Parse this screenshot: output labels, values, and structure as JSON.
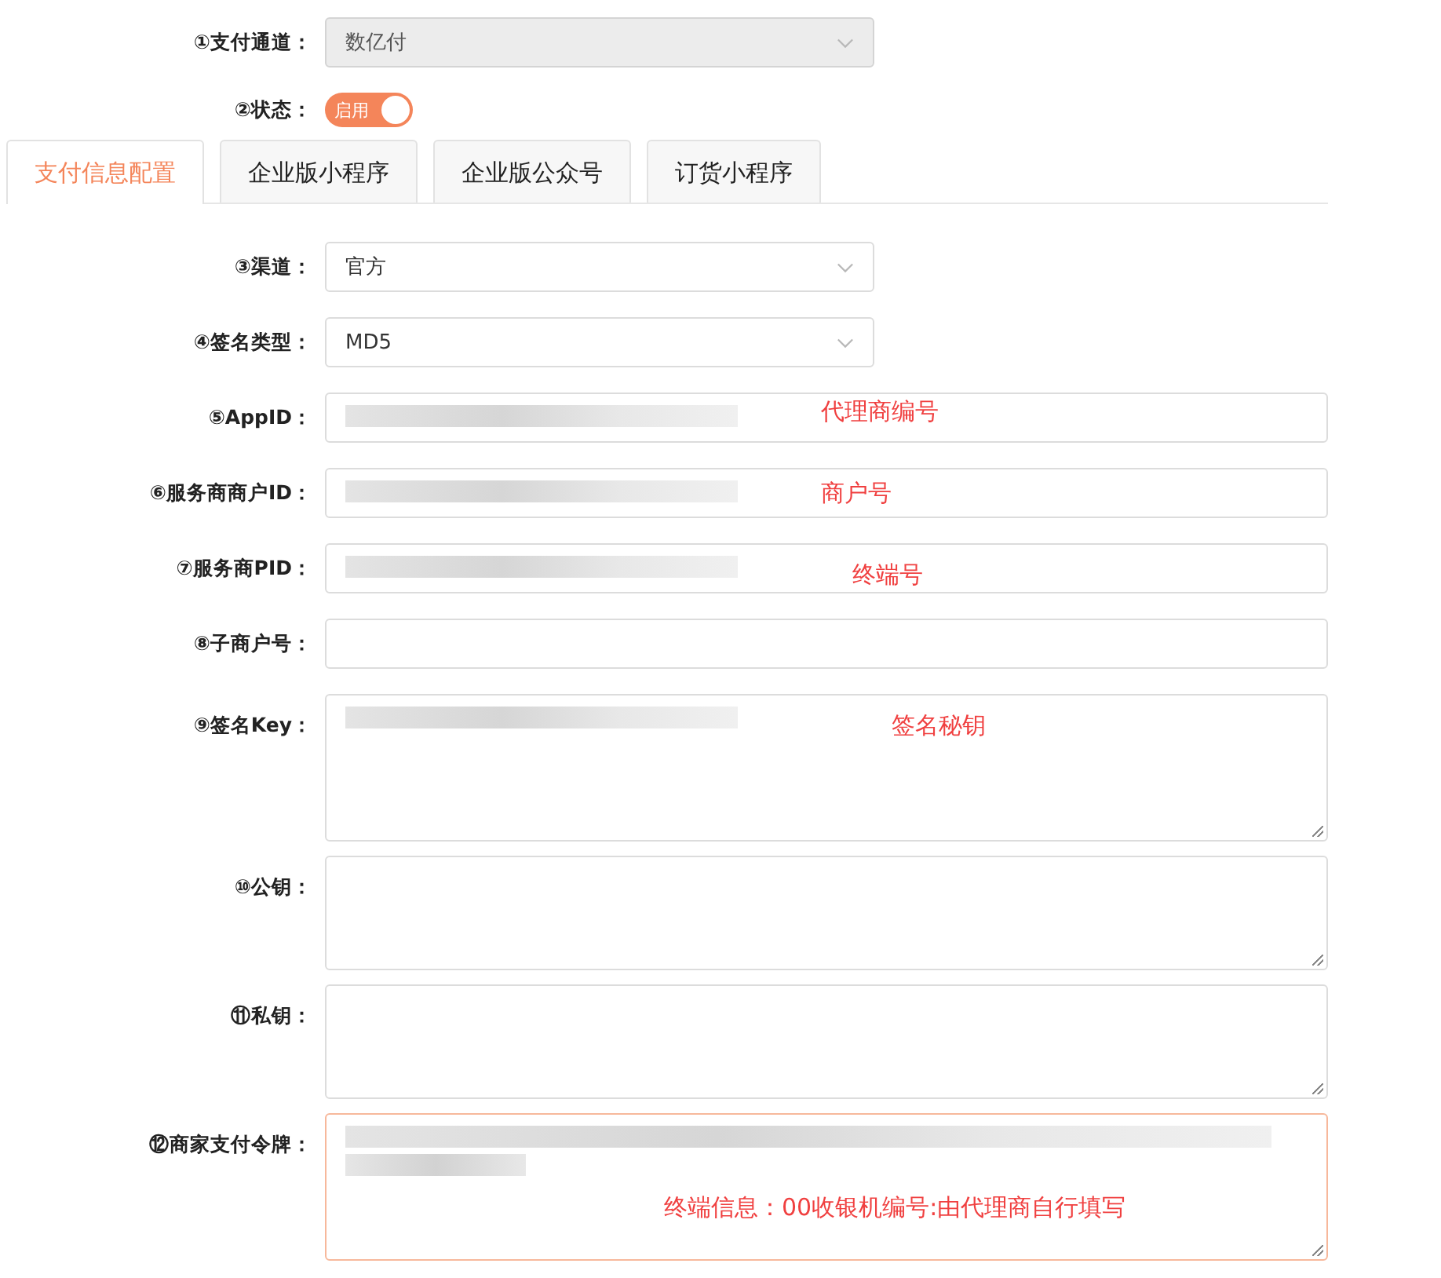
{
  "payment_channel": {
    "label": "①支付通道：",
    "value": "数亿付",
    "disabled": true
  },
  "status": {
    "label": "②状态：",
    "text": "启用",
    "on": true
  },
  "tabs": [
    {
      "label": "支付信息配置",
      "selected": true
    },
    {
      "label": "企业版小程序",
      "selected": false
    },
    {
      "label": "企业版公众号",
      "selected": false
    },
    {
      "label": "订货小程序",
      "selected": false
    }
  ],
  "fields": [
    {
      "kind": "select",
      "label": "③渠道：",
      "value": "官方",
      "redacted": false,
      "focused": false
    },
    {
      "kind": "select",
      "label": "④签名类型：",
      "value": "MD5",
      "redacted": false,
      "focused": false
    },
    {
      "kind": "text",
      "label": "⑤AppID：",
      "redacted": true,
      "focused": false,
      "annotation": "代理商编号"
    },
    {
      "kind": "text",
      "label": "⑥服务商商户ID：",
      "redacted": true,
      "focused": false,
      "annotation": "商户号"
    },
    {
      "kind": "text",
      "label": "⑦服务商PID：",
      "redacted": true,
      "focused": false,
      "annotation": "终端号"
    },
    {
      "kind": "text",
      "label": "⑧子商户号：",
      "redacted": false,
      "focused": false
    },
    {
      "kind": "memo",
      "label": "⑨签名Key：",
      "redacted": true,
      "focused": false,
      "annotation": "签名秘钥"
    },
    {
      "kind": "textarea",
      "label": "⑩公钥：",
      "redacted": false,
      "focused": false
    },
    {
      "kind": "textarea",
      "label": "⑪私钥：",
      "redacted": false,
      "focused": false
    },
    {
      "kind": "memo",
      "label": "⑫商家支付令牌：",
      "redacted": true,
      "focused": true,
      "annotation": "终端信息：00收银机编号:由代理商自行填写"
    }
  ]
}
